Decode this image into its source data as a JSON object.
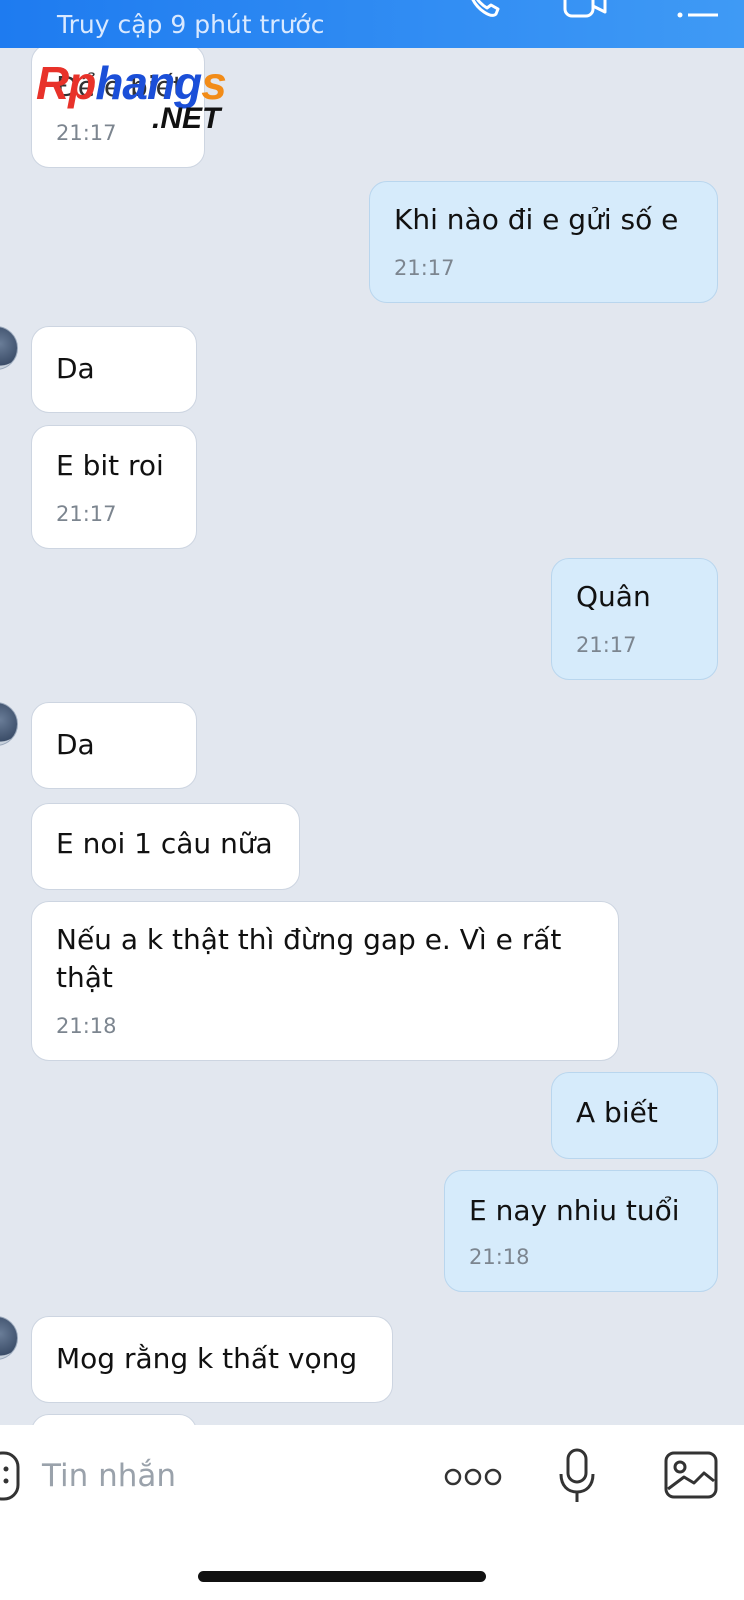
{
  "header": {
    "status": "Truy cập 9 phút trước",
    "icons": [
      "phone-icon",
      "video-icon",
      "menu-icon"
    ],
    "color": "#1e7bf0"
  },
  "watermark": {
    "part1": "Rp",
    "part2": "hang",
    "part3": "s",
    "net": ".NET"
  },
  "messages": [
    {
      "dir": "in",
      "text": "Để e biết",
      "time": "21:17"
    },
    {
      "dir": "out",
      "text": "Khi nào đi e gửi số e",
      "time": "21:17"
    },
    {
      "dir": "in",
      "text": "Da"
    },
    {
      "dir": "in",
      "text": "E bit roi",
      "time": "21:17"
    },
    {
      "dir": "out",
      "text": "Quân",
      "time": "21:17"
    },
    {
      "dir": "in",
      "text": "Da"
    },
    {
      "dir": "in",
      "text": "E noi 1 câu nữa"
    },
    {
      "dir": "in",
      "text": "Nếu a k thật thì đừng gap e.  Vì e rất",
      "text2": "thật",
      "time": "21:18"
    },
    {
      "dir": "out",
      "text": "A biết"
    },
    {
      "dir": "out",
      "text": "E nay nhiu tuổi",
      "time": "21:18"
    },
    {
      "dir": "in",
      "text": "Mog rằng k thất vọng"
    }
  ],
  "input": {
    "placeholder": "Tin nhắn",
    "icons": [
      "sticker-icon",
      "more-icon",
      "microphone-icon",
      "image-icon"
    ]
  },
  "colors": {
    "incoming": "#ffffff",
    "outgoing": "#d6ebfb",
    "background": "#e2e7ef"
  }
}
